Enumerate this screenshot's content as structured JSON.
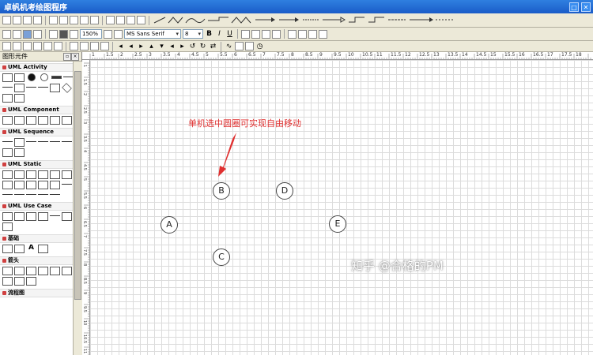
{
  "window": {
    "title": "卓帆机考绘图程序",
    "maximize_glyph": "□",
    "close_glyph": "✕"
  },
  "toolbar": {
    "zoom_value": "150%",
    "font_name": "MS Sans Serif",
    "font_size": "8",
    "bold_label": "B",
    "italic_label": "I",
    "underline_label": "U"
  },
  "panel": {
    "title": "图形元件",
    "groups": [
      {
        "name": "UML Activity"
      },
      {
        "name": "UML Component"
      },
      {
        "name": "UML Sequence"
      },
      {
        "name": "UML Static"
      },
      {
        "name": "UML Use Case"
      },
      {
        "name": "基础"
      },
      {
        "name": "箭头"
      },
      {
        "name": "流程图"
      }
    ],
    "text_shape_label": "A"
  },
  "ruler": {
    "top_labels": [
      "1",
      "1.5",
      "2",
      "2.5",
      "3",
      "3.5",
      "4",
      "4.5",
      "5",
      "5.5",
      "6",
      "6.5",
      "7",
      "7.5",
      "8",
      "8.5",
      "9",
      "9.5",
      "10",
      "10.5",
      "11",
      "11.5",
      "12",
      "12.5",
      "13",
      "13.5",
      "14",
      "14.5",
      "15",
      "15.5",
      "16",
      "16.5",
      "17",
      "17.5",
      "18"
    ],
    "left_labels": [
      "1",
      "1.5",
      "2",
      "2.5",
      "3",
      "3.5",
      "4",
      "4.5",
      "5",
      "5.5",
      "6",
      "6.5",
      "7",
      "7.5",
      "8",
      "8.5",
      "9",
      "9.5",
      "10",
      "10.5",
      "11"
    ]
  },
  "canvas": {
    "annotation": "单机选中圆圈可实现自由移动",
    "annotation_color": "#e03030",
    "nodes": [
      {
        "label": "A"
      },
      {
        "label": "B"
      },
      {
        "label": "C"
      },
      {
        "label": "D"
      },
      {
        "label": "E"
      }
    ]
  },
  "watermark": "知乎 @合格的PM",
  "colors": {
    "titlebar": "#1a5cc8",
    "grid_line": "#dcdcdc",
    "annotation": "#e03030"
  }
}
